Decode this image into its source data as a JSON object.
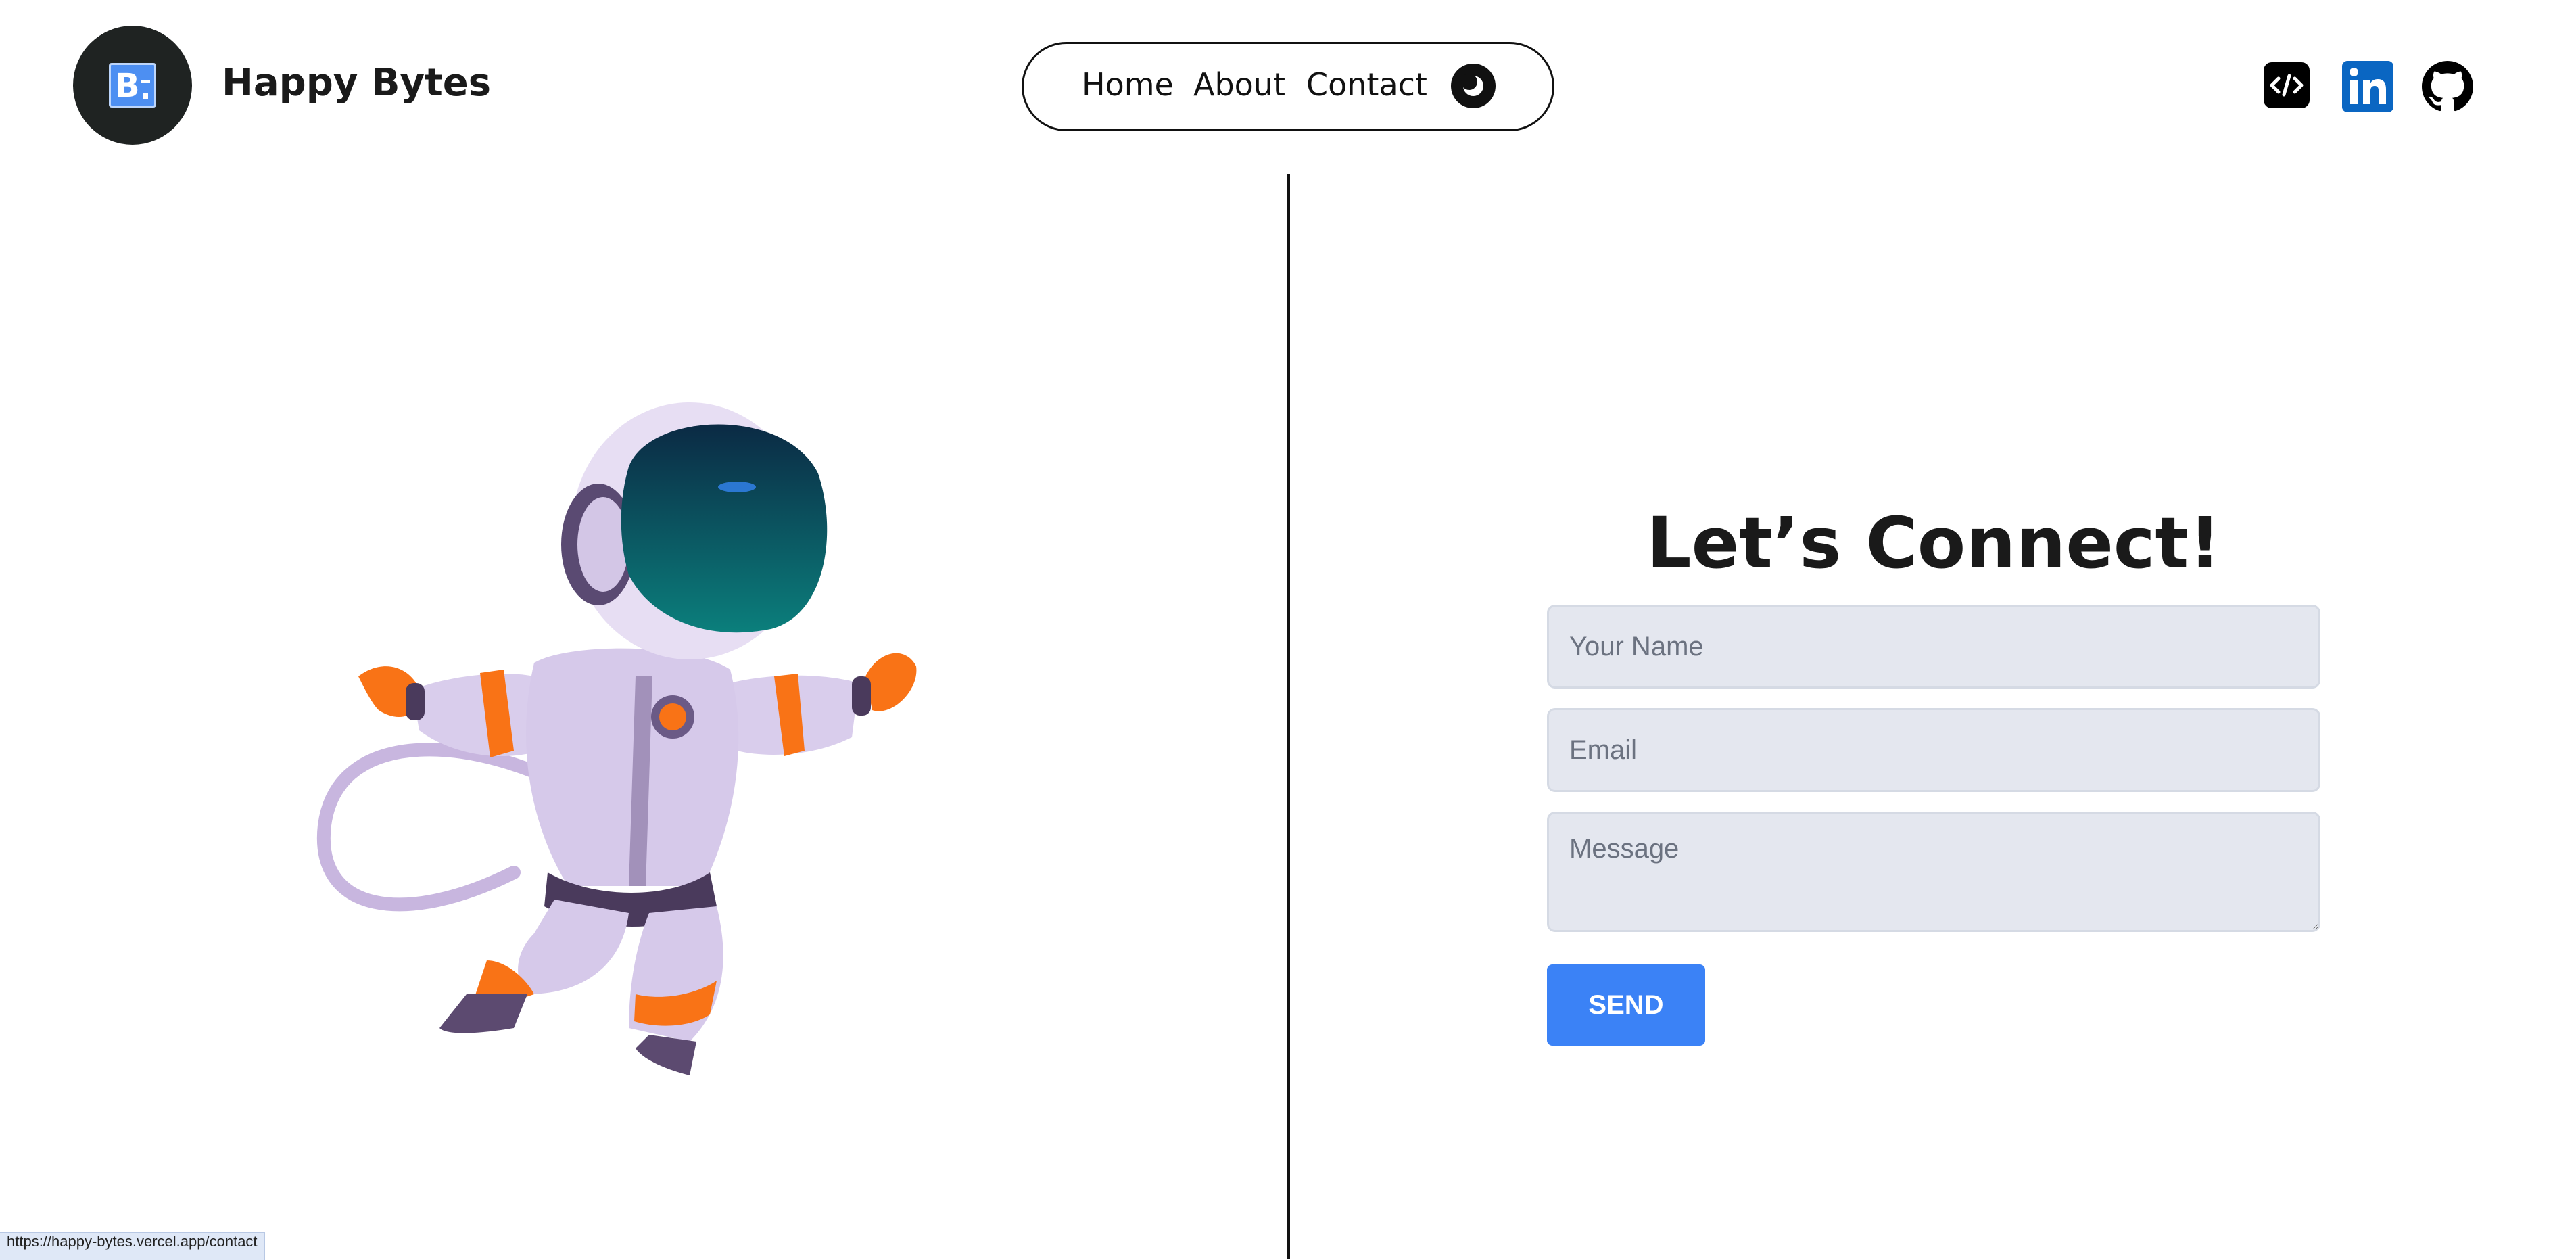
{
  "header": {
    "brand": "Happy Bytes",
    "logo_icon": "b-logo-icon"
  },
  "nav": {
    "links": [
      "Home",
      "About",
      "Contact"
    ],
    "theme_toggle_icon": "moon-icon"
  },
  "socials": [
    {
      "icon": "code-icon"
    },
    {
      "icon": "linkedin-icon",
      "color": "#0a66c2"
    },
    {
      "icon": "github-icon"
    }
  ],
  "main": {
    "illustration": "astronaut-illustration",
    "heading": "Let’s Connect!"
  },
  "form": {
    "name_placeholder": "Your Name",
    "email_placeholder": "Email",
    "message_placeholder": "Message",
    "send_label": "SEND"
  },
  "status": {
    "url": "https://happy-bytes.vercel.app/contact"
  },
  "colors": {
    "accent": "#3b82f6",
    "input_bg": "#e4e7ef",
    "logo_bg": "#1f2322",
    "suit_orange": "#f97316"
  }
}
